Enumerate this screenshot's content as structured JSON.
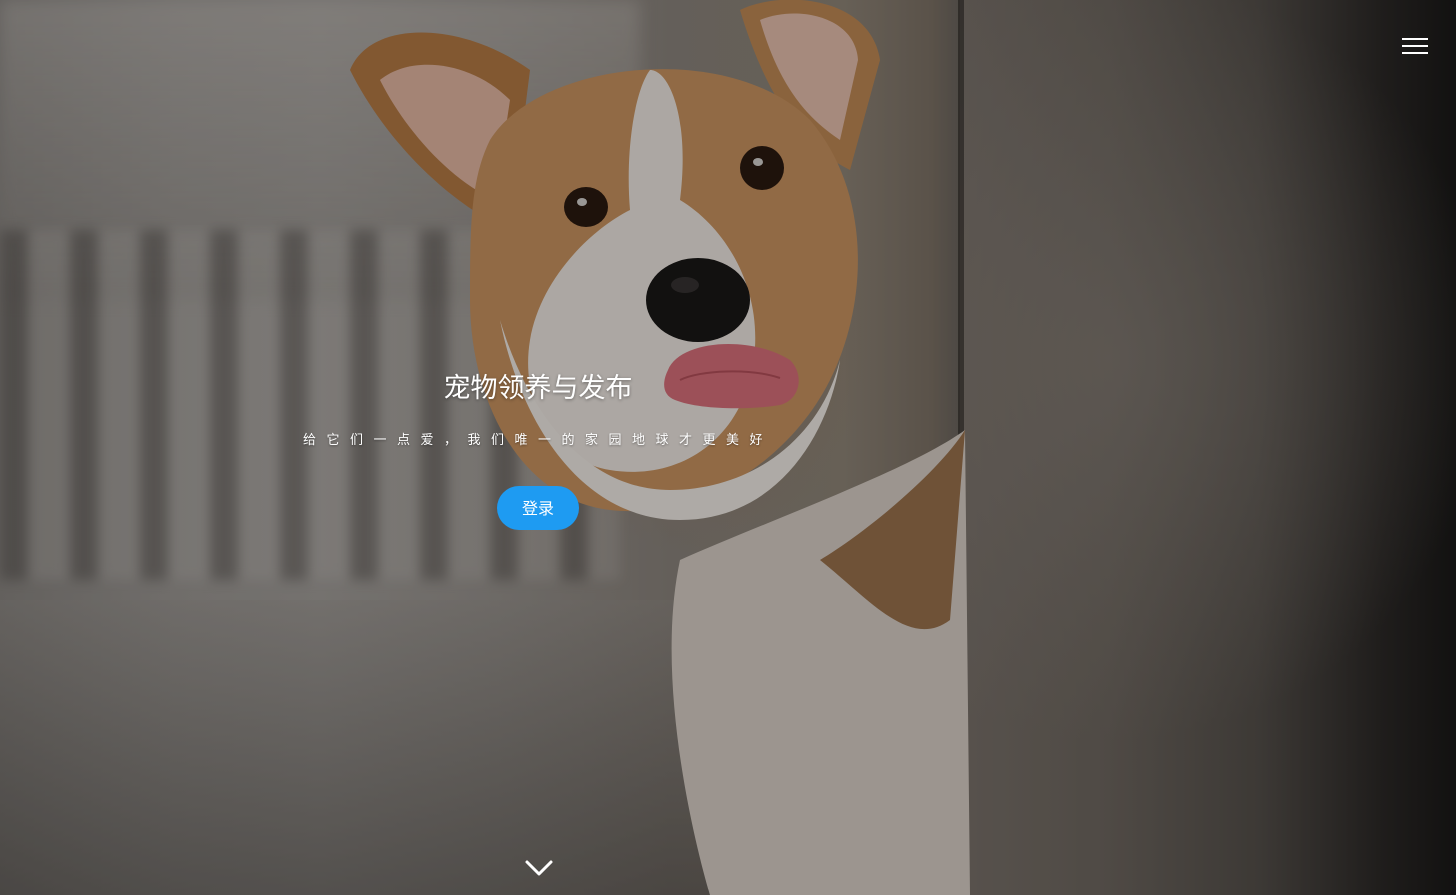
{
  "header": {
    "menu_icon": "hamburger-menu-icon"
  },
  "hero": {
    "title": "宠物领养与发布",
    "subtitle": "给它们一点爱，我们唯一的家园地球才更美好",
    "login_label": "登录",
    "scroll_icon": "chevron-down-icon"
  },
  "colors": {
    "accent": "#1e9bf2",
    "text": "#ffffff"
  }
}
